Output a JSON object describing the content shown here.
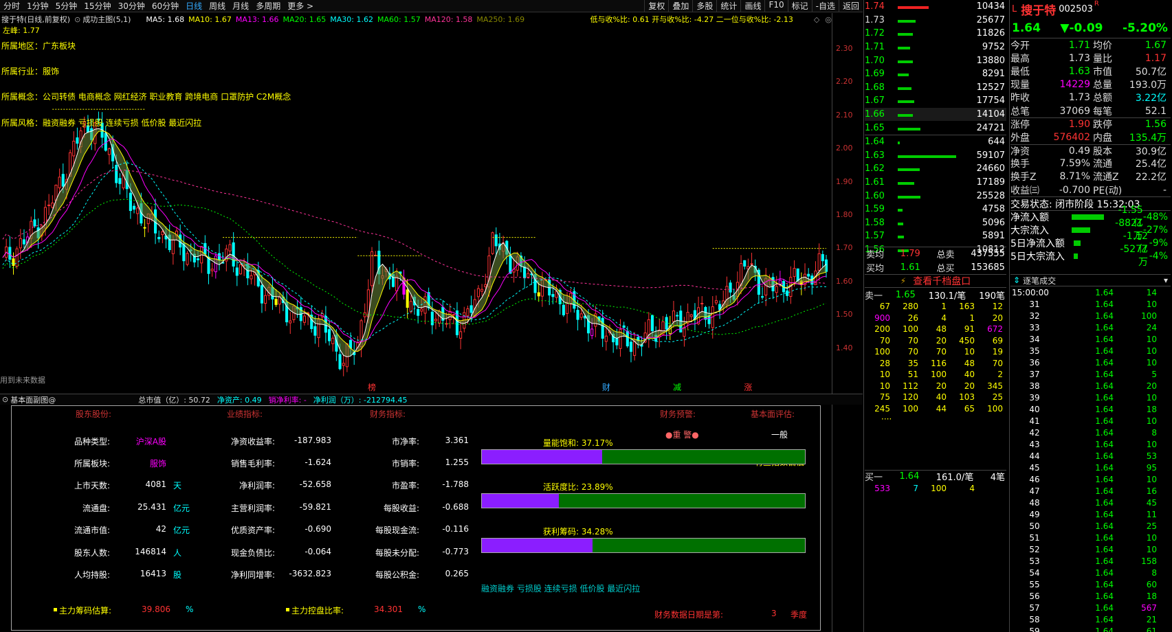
{
  "toolbar": {
    "periods": [
      "分时",
      "1分钟",
      "5分钟",
      "15分钟",
      "30分钟",
      "60分钟",
      "日线",
      "周线",
      "月线",
      "多周期",
      "更多 >"
    ],
    "active_period": "日线",
    "right_tools": [
      "复权",
      "叠加",
      "多股",
      "统计",
      "画线",
      "F10",
      "标记",
      "-自选",
      "返回"
    ]
  },
  "chart_header": {
    "title": "搜于特(日线,前复权)",
    "indicator": "成功主图(5,1)",
    "ma": [
      {
        "label": "MA5: 1.68",
        "color": "#ffffff"
      },
      {
        "label": "MA10: 1.67",
        "color": "#ffff00"
      },
      {
        "label": "MA13: 1.66",
        "color": "#ff00ff"
      },
      {
        "label": "MA20: 1.65",
        "color": "#00ff00"
      },
      {
        "label": "MA30: 1.62",
        "color": "#00ffff"
      },
      {
        "label": "MA60: 1.57",
        "color": "#00ff00"
      },
      {
        "label": "MA120: 1.58",
        "color": "#ff3399"
      },
      {
        "label": "MA250: 1.69",
        "color": "#888800"
      }
    ],
    "ratios": "低与收%比: 0.61  开与收%比: -4.27  二一位与收%比: -2.13",
    "left_peak": "左峰: 1.77"
  },
  "fields": [
    {
      "label": "所属地区：",
      "value": "广东板块"
    },
    {
      "label": "所属行业：",
      "value": "服饰"
    },
    {
      "label": "所属概念：",
      "value": "公司转债 电商概念 网红经济 职业教育 跨境电商 口罩防护 C2M概念"
    },
    {
      "label": "所属风格：",
      "value": "融资融券 亏损股 连续亏损 低价股 最近闪拉"
    }
  ],
  "future_note": "用到未来数据",
  "price_axis": [
    "2.30",
    "2.20",
    "2.10",
    "2.00",
    "1.90",
    "1.80",
    "1.70",
    "1.60",
    "1.50",
    "1.40"
  ],
  "event_marks": [
    {
      "text": "榜",
      "color": "#f33"
    },
    {
      "text": "财",
      "color": "#3af"
    },
    {
      "text": "减",
      "color": "#0f0"
    },
    {
      "text": "涨",
      "color": "#f33"
    }
  ],
  "fund_header": {
    "title": "基本面副图@",
    "items": [
      {
        "text": "总市值（亿）: 50.72",
        "color": "#dddddd"
      },
      {
        "text": "净资产: 0.49",
        "color": "#00ffff"
      },
      {
        "text": "销净利率: -",
        "color": "#ff00ff"
      },
      {
        "text": "净利润（万）: -212794.45",
        "color": "#00ffff"
      }
    ]
  },
  "fund": {
    "col_headers": [
      "股东股份:",
      "业绩指标:",
      "财务指标:",
      "财务预警:",
      "基本面评估:"
    ],
    "col1": [
      {
        "label": "品种类型:",
        "value": "沪深A股",
        "unit": ""
      },
      {
        "label": "所属板块:",
        "value": "服饰",
        "unit": ""
      },
      {
        "label": "上市天数:",
        "value": "4081",
        "unit": "天"
      },
      {
        "label": "流通盘:",
        "value": "25.431",
        "unit": "亿元"
      },
      {
        "label": "流通市值:",
        "value": "42",
        "unit": "亿元"
      },
      {
        "label": "股东人数:",
        "value": "146814",
        "unit": "人"
      },
      {
        "label": "人均持股:",
        "value": "16413",
        "unit": "股"
      }
    ],
    "col2": [
      {
        "label": "净资收益率:",
        "value": "-187.983"
      },
      {
        "label": "销售毛利率:",
        "value": "-1.624"
      },
      {
        "label": "净利润率:",
        "value": "-52.658"
      },
      {
        "label": "主营利润率:",
        "value": "-59.821"
      },
      {
        "label": "优质资产率:",
        "value": "-0.690"
      },
      {
        "label": "现金负债比:",
        "value": "-0.064"
      },
      {
        "label": "净利同增率:",
        "value": "-3632.823"
      }
    ],
    "col3": [
      {
        "label": "市净率:",
        "value": "3.361"
      },
      {
        "label": "市销率:",
        "value": "1.255"
      },
      {
        "label": "市盈率:",
        "value": "-1.788"
      },
      {
        "label": "每股收益:",
        "value": "-0.688"
      },
      {
        "label": "每股现金流:",
        "value": "-0.116"
      },
      {
        "label": "每股未分配:",
        "value": "-0.773"
      },
      {
        "label": "每股公积金:",
        "value": "0.265"
      }
    ],
    "warning": "●重 警●",
    "rating": "一般",
    "index_note": "有些指数偏低",
    "bars": [
      {
        "label": "量能饱和: 37.17%",
        "fraction": 0.3717
      },
      {
        "label": "活跃度比: 23.89%",
        "fraction": 0.2389
      },
      {
        "label": "获利筹码: 34.28%",
        "fraction": 0.3428
      }
    ],
    "styles": "融资融券 亏损股 连续亏损 低价股 最近闪拉",
    "chip1_label": "主力筹码估算:",
    "chip1_value": "39.806",
    "chip1_unit": "%",
    "chip2_label": "主力控盘比率:",
    "chip2_value": "34.301",
    "chip2_unit": "%",
    "report_label": "财务数据日期是第:",
    "report_value": "3",
    "report_unit": "季度"
  },
  "orderbook": {
    "asks": [
      {
        "price": "1.74",
        "vol": "10434",
        "bar": 0.45
      },
      {
        "price": "1.73",
        "vol": "25677",
        "bar": 0.26
      },
      {
        "price": "1.72",
        "vol": "11826",
        "bar": 0.22
      },
      {
        "price": "1.71",
        "vol": "9752",
        "bar": 0.18
      },
      {
        "price": "1.70",
        "vol": "13880",
        "bar": 0.22
      },
      {
        "price": "1.69",
        "vol": "8291",
        "bar": 0.16
      },
      {
        "price": "1.68",
        "vol": "12527",
        "bar": 0.2
      },
      {
        "price": "1.67",
        "vol": "17754",
        "bar": 0.24
      },
      {
        "price": "1.66",
        "vol": "14104",
        "bar": 0.22
      },
      {
        "price": "1.65",
        "vol": "24721",
        "bar": 0.33
      }
    ],
    "bids": [
      {
        "price": "1.64",
        "vol": "644",
        "bar": 0.03
      },
      {
        "price": "1.63",
        "vol": "59107",
        "bar": 0.85
      },
      {
        "price": "1.62",
        "vol": "24660",
        "bar": 0.32
      },
      {
        "price": "1.61",
        "vol": "17189",
        "bar": 0.24
      },
      {
        "price": "1.60",
        "vol": "25528",
        "bar": 0.33
      },
      {
        "price": "1.59",
        "vol": "4758",
        "bar": 0.07
      },
      {
        "price": "1.58",
        "vol": "5096",
        "bar": 0.08
      },
      {
        "price": "1.57",
        "vol": "5891",
        "bar": 0.09
      },
      {
        "price": "1.56",
        "vol": "10812",
        "bar": 0.16
      }
    ],
    "sell_avg": {
      "label": "卖均",
      "value": "1.79",
      "label2": "总卖",
      "value2": "437555"
    },
    "buy_avg": {
      "label": "买均",
      "value": "1.61",
      "label2": "总买",
      "value2": "153685"
    },
    "depth_link": "查看千档盘口",
    "sell1": {
      "label": "卖一",
      "price": "1.65",
      "per": "130.1/笔",
      "count": "190笔",
      "grid": [
        [
          "67",
          "280",
          "1",
          "163",
          "12"
        ],
        [
          "900",
          "26",
          "4",
          "1",
          "20"
        ],
        [
          "200",
          "100",
          "48",
          "91",
          "672"
        ],
        [
          "70",
          "70",
          "20",
          "450",
          "69"
        ],
        [
          "100",
          "70",
          "70",
          "10",
          "19"
        ],
        [
          "28",
          "35",
          "116",
          "48",
          "70"
        ],
        [
          "10",
          "51",
          "100",
          "40",
          "2"
        ],
        [
          "10",
          "112",
          "20",
          "20",
          "345"
        ],
        [
          "75",
          "120",
          "40",
          "103",
          "25"
        ],
        [
          "245",
          "100",
          "44",
          "65",
          "100"
        ]
      ],
      "more": "····"
    },
    "buy1": {
      "label": "买一",
      "price": "1.64",
      "per": "161.0/笔",
      "count": "4笔",
      "grid": [
        "533",
        "7",
        "100",
        "4"
      ]
    }
  },
  "quote": {
    "flag": "L",
    "name": "搜于特",
    "code": "002503",
    "badge": "R",
    "price": "1.64",
    "change": "▼-0.09",
    "pct": "-5.20%",
    "rows": [
      [
        {
          "l": "今开",
          "v": "1.71",
          "c": "#00ff00"
        },
        {
          "l": "均价",
          "v": "1.67",
          "c": "#00ff00"
        }
      ],
      [
        {
          "l": "最高",
          "v": "1.73",
          "c": "#dddddd"
        },
        {
          "l": "量比",
          "v": "1.17",
          "c": "#ff3333"
        }
      ],
      [
        {
          "l": "最低",
          "v": "1.63",
          "c": "#00ff00"
        },
        {
          "l": "市值",
          "v": "50.7亿",
          "c": "#dddddd"
        }
      ],
      [
        {
          "l": "现量",
          "v": "14229",
          "c": "#ff00ff"
        },
        {
          "l": "总量",
          "v": "193.0万",
          "c": "#dddddd"
        }
      ],
      [
        {
          "l": "昨收",
          "v": "1.73",
          "c": "#dddddd"
        },
        {
          "l": "总额",
          "v": "3.22亿",
          "c": "#00ffff"
        }
      ],
      [
        {
          "l": "总笔",
          "v": "37069",
          "c": "#dddddd"
        },
        {
          "l": "每笔",
          "v": "52.1",
          "c": "#dddddd"
        }
      ],
      [
        {
          "l": "涨停",
          "v": "1.90",
          "c": "#ff3333"
        },
        {
          "l": "跌停",
          "v": "1.56",
          "c": "#00ff00"
        }
      ],
      [
        {
          "l": "外盘",
          "v": "576402",
          "c": "#ff3333"
        },
        {
          "l": "内盘",
          "v": "135.4万",
          "c": "#00ff00"
        }
      ],
      [
        {
          "l": "净资",
          "v": "0.49",
          "c": "#dddddd"
        },
        {
          "l": "股本",
          "v": "30.9亿",
          "c": "#dddddd"
        }
      ],
      [
        {
          "l": "换手",
          "v": "7.59%",
          "c": "#dddddd"
        },
        {
          "l": "流通",
          "v": "25.4亿",
          "c": "#dddddd"
        }
      ],
      [
        {
          "l": "换手Z",
          "v": "8.71%",
          "c": "#dddddd"
        },
        {
          "l": "流通Z",
          "v": "22.2亿",
          "c": "#dddddd"
        }
      ],
      [
        {
          "l": "收益㈢",
          "v": "-0.700",
          "c": "#dddddd"
        },
        {
          "l": "PE(动)",
          "v": "-",
          "c": "#dddddd"
        }
      ]
    ],
    "trade_state": "交易状态: 闭市阶段 15:32:03",
    "flows": [
      {
        "label": "净流入额",
        "value": "-1.55亿",
        "pct": "-48%",
        "bar": 0.85
      },
      {
        "label": "大宗流入",
        "value": "-8821万",
        "pct": "-27%",
        "bar": 0.48
      },
      {
        "label": "5日净流入额",
        "value": "-1.12亿",
        "pct": "-9%",
        "bar": 0.18
      },
      {
        "label": "5日大宗流入",
        "value": "-5277万",
        "pct": "-4%",
        "bar": 0.1
      }
    ]
  },
  "ticks": {
    "title": "逐笔成交",
    "first_time": "15:00:00",
    "rows": [
      [
        "15:00:00",
        "1.64",
        "14"
      ],
      [
        "31",
        "1.64",
        "10"
      ],
      [
        "32",
        "1.64",
        "100"
      ],
      [
        "33",
        "1.64",
        "24"
      ],
      [
        "34",
        "1.64",
        "10"
      ],
      [
        "35",
        "1.64",
        "10"
      ],
      [
        "36",
        "1.64",
        "10"
      ],
      [
        "37",
        "1.64",
        "5"
      ],
      [
        "38",
        "1.64",
        "20"
      ],
      [
        "39",
        "1.64",
        "10"
      ],
      [
        "40",
        "1.64",
        "18"
      ],
      [
        "41",
        "1.64",
        "10"
      ],
      [
        "42",
        "1.64",
        "8"
      ],
      [
        "43",
        "1.64",
        "10"
      ],
      [
        "44",
        "1.64",
        "53"
      ],
      [
        "45",
        "1.64",
        "95"
      ],
      [
        "46",
        "1.64",
        "10"
      ],
      [
        "47",
        "1.64",
        "16"
      ],
      [
        "48",
        "1.64",
        "45"
      ],
      [
        "49",
        "1.64",
        "11"
      ],
      [
        "50",
        "1.64",
        "25"
      ],
      [
        "51",
        "1.64",
        "10"
      ],
      [
        "52",
        "1.64",
        "10"
      ],
      [
        "53",
        "1.64",
        "158"
      ],
      [
        "54",
        "1.64",
        "8"
      ],
      [
        "55",
        "1.64",
        "60"
      ],
      [
        "56",
        "1.64",
        "18"
      ],
      [
        "57",
        "1.64",
        "567"
      ],
      [
        "58",
        "1.64",
        "21"
      ],
      [
        "59",
        "1.64",
        "61"
      ]
    ]
  }
}
